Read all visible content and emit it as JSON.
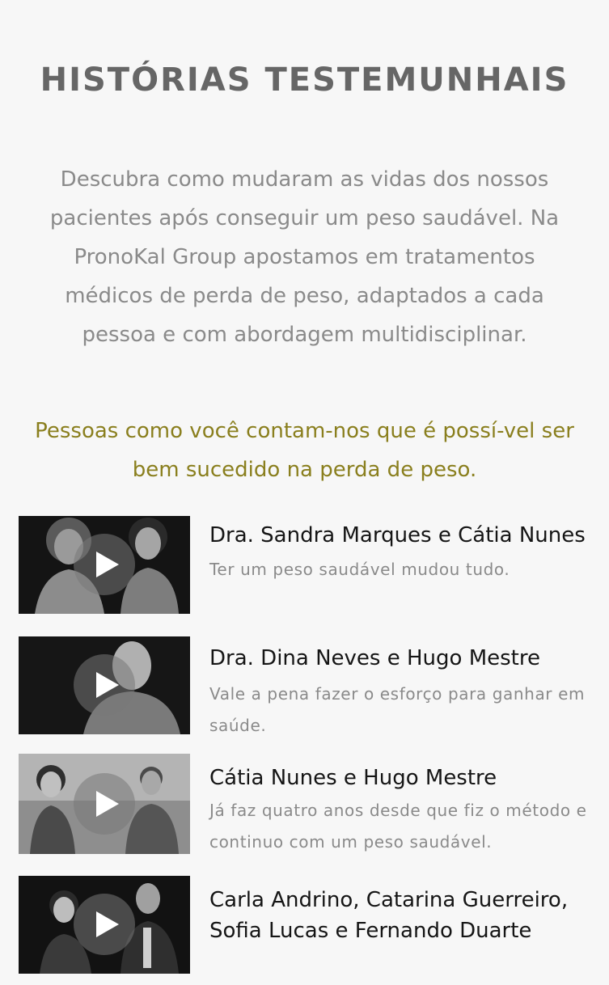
{
  "section": {
    "title": "HISTÓRIAS TESTEMUNHAIS",
    "intro": "Descubra como mudaram as vidas dos nossos pacientes após conseguir um peso saudável. Na PronoKal Group apostamos em tratamentos médicos de perda de peso, adaptados a cada pessoa e com abordagem multidisciplinar.",
    "highlight": "Pessoas como você contam-nos que é possí-vel ser bem sucedido na perda de peso."
  },
  "testimonials": [
    {
      "title": "Dra. Sandra Marques e Cátia Nunes",
      "quote": "Ter um peso saudável mudou tudo.",
      "play_icon": "play-icon"
    },
    {
      "title": "Dra. Dina Neves e Hugo Mestre",
      "quote": "Vale a pena fazer o esforço para ganhar em saúde.",
      "play_icon": "play-icon"
    },
    {
      "title": "Cátia Nunes e Hugo Mestre",
      "quote": "Já faz quatro anos desde que fiz o método e continuo com um peso saudável.",
      "play_icon": "play-icon"
    },
    {
      "title": "Carla Andrino, Catarina Guerreiro, Sofia Lucas e Fernando Duarte",
      "quote": "",
      "play_icon": "play-icon"
    }
  ],
  "colors": {
    "background": "#f7f7f7",
    "heading": "#666666",
    "body_text": "#8a8a8a",
    "accent": "#8a7f1e",
    "title_text": "#151515"
  }
}
